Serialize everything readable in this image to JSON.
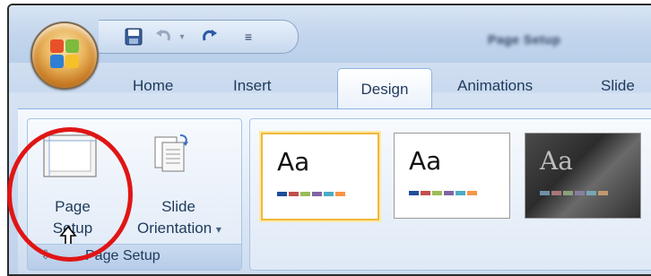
{
  "window": {
    "title": "Page Setup"
  },
  "qat": {
    "save_icon": "save-icon",
    "undo_icon": "undo-icon",
    "redo_icon": "redo-icon",
    "customize_icon": "customize-qat-icon"
  },
  "tabs": [
    {
      "label": "Home"
    },
    {
      "label": "Insert"
    },
    {
      "label": "Design",
      "active": true
    },
    {
      "label": "Animations"
    },
    {
      "label": "Slide"
    }
  ],
  "ribbon": {
    "page_setup_group": {
      "label": "Page Setup",
      "page_setup_line1": "Page",
      "page_setup_line2": "Setup",
      "slide_orientation_line1": "Slide",
      "slide_orientation_line2": "Orientation",
      "dropdown_glyph": "▾"
    },
    "themes": [
      {
        "text": "Aa",
        "selected": true
      },
      {
        "text": "Aa",
        "selected": false
      },
      {
        "text": "Aa",
        "selected": false
      }
    ]
  },
  "colors": {
    "accent_highlight": "#e01515",
    "selected_theme_border": "#f0b83c",
    "tab_text": "#1e395b"
  }
}
